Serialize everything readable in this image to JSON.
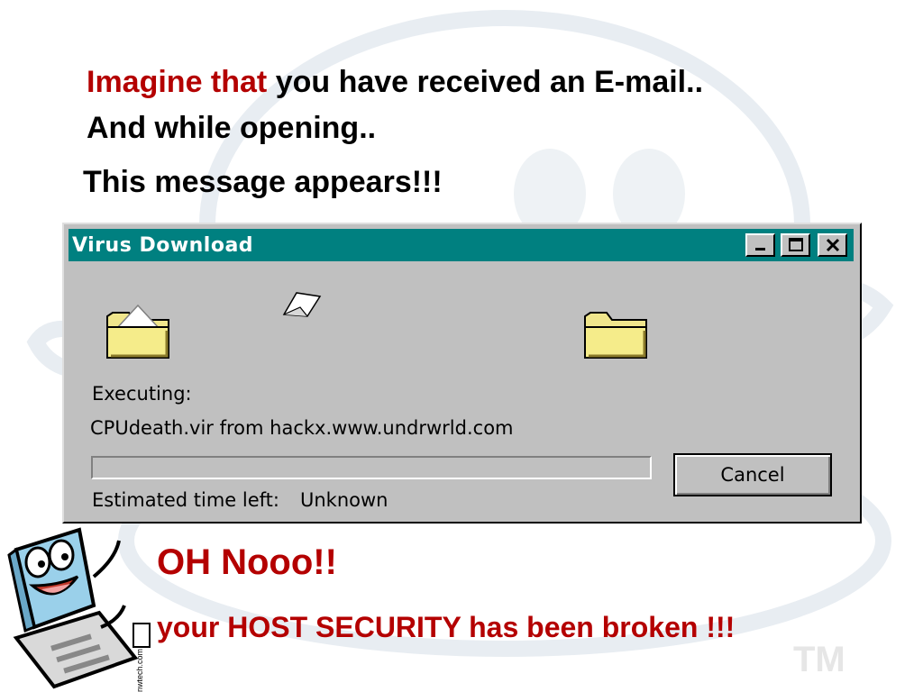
{
  "slide": {
    "line1_red": "Imagine that",
    "line1_rest": " you have received an E-mail..",
    "line2": "And while opening..",
    "line3": "This message appears!!!",
    "exclaim": "OH Nooo!!",
    "warning": "your HOST SECURITY has been broken !!!",
    "mascot_caption": "nwtech.com"
  },
  "dialog": {
    "title": "Virus Download",
    "executing_label": "Executing:",
    "file_text": "CPUdeath.vir from hackx.www.undrwrld.com",
    "time_left_label": "Estimated time left:",
    "time_left_value": "Unknown",
    "cancel_label": "Cancel",
    "progress": 0
  },
  "colors": {
    "accent_red": "#b40000",
    "titlebar": "#008080",
    "window_face": "#c0c0c0"
  },
  "icons": [
    "folder-icon",
    "flying-paper-icon",
    "minimize-icon",
    "maximize-icon",
    "close-icon",
    "computer-mascot-icon"
  ]
}
